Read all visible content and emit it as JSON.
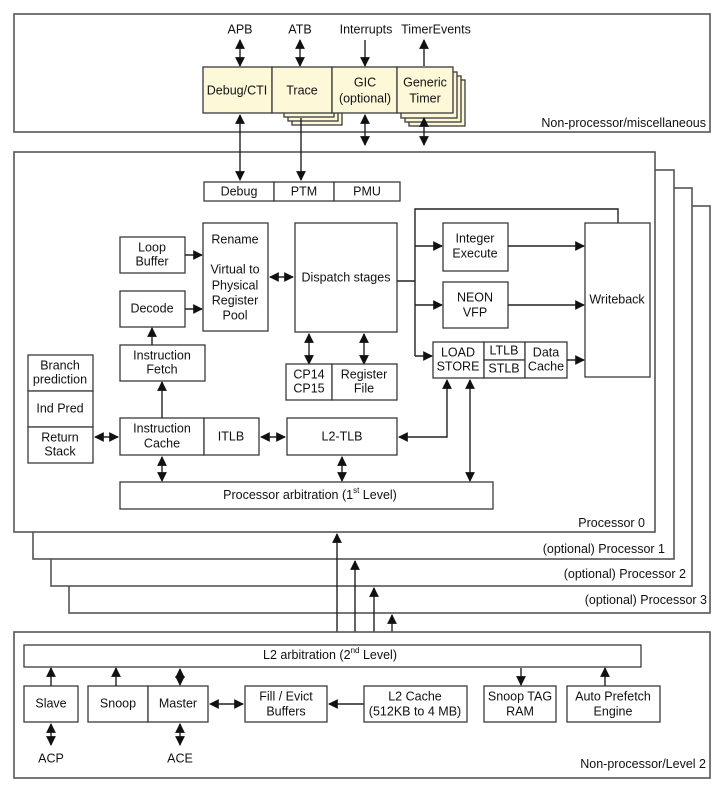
{
  "top_section": {
    "label": "Non-processor/miscellaneous",
    "interfaces": [
      "APB",
      "ATB",
      "Interrupts",
      "TimerEvents"
    ],
    "blocks": {
      "debug_cti": "Debug/CTI",
      "trace": "Trace",
      "gic_line1": "GIC",
      "gic_line2": "(optional)",
      "timer_line1": "Generic",
      "timer_line2": "Timer"
    }
  },
  "processor": {
    "labels": [
      "Processor 0",
      "(optional) Processor 1",
      "(optional) Processor 2",
      "(optional) Processor 3"
    ],
    "debug_strip": [
      "Debug",
      "PTM",
      "PMU"
    ],
    "loop_buffer": [
      "Loop",
      "Buffer"
    ],
    "decode": "Decode",
    "rename": [
      "Rename",
      "",
      "Virtual to",
      "Physical",
      "Register",
      "Pool"
    ],
    "dispatch": "Dispatch stages",
    "integer_execute": [
      "Integer",
      "Execute"
    ],
    "neon_vfp": [
      "NEON",
      "VFP"
    ],
    "load_store": [
      "LOAD",
      "STORE"
    ],
    "ltlb": "LTLB",
    "stlb": "STLB",
    "data_cache": [
      "Data",
      "Cache"
    ],
    "writeback": "Writeback",
    "cp14_cp15": [
      "CP14",
      "CP15"
    ],
    "register_file": [
      "Register",
      "File"
    ],
    "instruction_fetch": [
      "Instruction",
      "Fetch"
    ],
    "branch_prediction": [
      "Branch",
      "prediction"
    ],
    "ind_pred": "Ind Pred",
    "return_stack": [
      "Return",
      "Stack"
    ],
    "instruction_cache": [
      "Instruction",
      "Cache"
    ],
    "itlb": "ITLB",
    "l2_tlb": "L2-TLB",
    "arbitration_prefix": "Processor arbitration (1",
    "arbitration_sup": "st",
    "arbitration_suffix": " Level)"
  },
  "level2": {
    "label": "Non-processor/Level 2",
    "arbitration_prefix": "L2 arbitration (2",
    "arbitration_sup": "nd",
    "arbitration_suffix": " Level)",
    "slave": "Slave",
    "snoop": "Snoop",
    "master": "Master",
    "fill_evict": [
      "Fill / Evict",
      "Buffers"
    ],
    "l2_cache": [
      "L2 Cache",
      "(512KB to 4 MB)"
    ],
    "snoop_tag": [
      "Snoop TAG",
      "RAM"
    ],
    "auto_prefetch": [
      "Auto Prefetch",
      "Engine"
    ],
    "interfaces": [
      "ACP",
      "ACE"
    ]
  }
}
